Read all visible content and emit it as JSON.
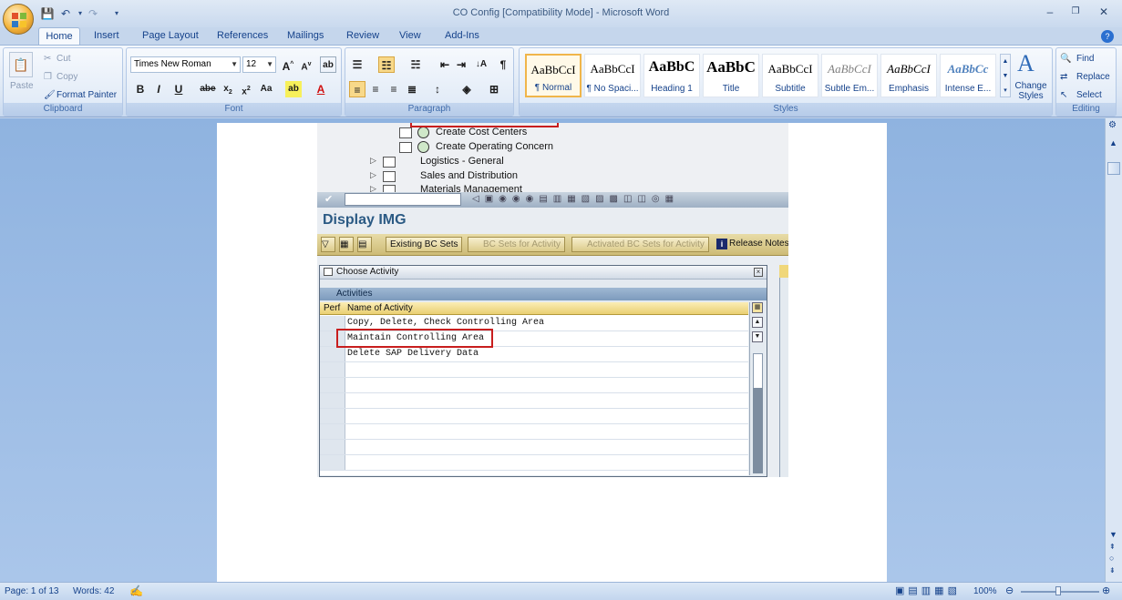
{
  "window": {
    "title": "CO Config [Compatibility Mode] - Microsoft Word",
    "controls": {
      "minimize": "–",
      "restore": "❐",
      "close": "✕"
    }
  },
  "tabs": [
    "Home",
    "Insert",
    "Page Layout",
    "References",
    "Mailings",
    "Review",
    "View",
    "Add-Ins"
  ],
  "ribbon": {
    "clipboard": {
      "label": "Clipboard",
      "paste": "Paste",
      "cut": "Cut",
      "copy": "Copy",
      "format_painter": "Format Painter"
    },
    "font": {
      "label": "Font",
      "name": "Times New Roman",
      "size": "12"
    },
    "paragraph": {
      "label": "Paragraph"
    },
    "styles": {
      "label": "Styles",
      "items": [
        {
          "preview": "AaBbCcI",
          "name": "¶ Normal"
        },
        {
          "preview": "AaBbCcI",
          "name": "¶ No Spaci..."
        },
        {
          "preview": "AaBbC",
          "name": "Heading 1"
        },
        {
          "preview": "AaBbC",
          "name": "Title"
        },
        {
          "preview": "AaBbCcI",
          "name": "Subtitle"
        },
        {
          "preview": "AaBbCcI",
          "name": "Subtle Em..."
        },
        {
          "preview": "AaBbCcI",
          "name": "Emphasis"
        },
        {
          "preview": "AaBbCc",
          "name": "Intense E..."
        }
      ],
      "change_styles": "Change Styles"
    },
    "editing": {
      "label": "Editing",
      "find": "Find",
      "replace": "Replace",
      "select": "Select"
    }
  },
  "sap": {
    "tree": [
      {
        "text": "Create Cost Centers",
        "kind": "activity"
      },
      {
        "text": "Create Operating Concern",
        "kind": "activity"
      },
      {
        "text": "Logistics - General",
        "kind": "folder"
      },
      {
        "text": "Sales and Distribution",
        "kind": "folder"
      },
      {
        "text": "Materials Management",
        "kind": "folder"
      }
    ],
    "screen_title": "Display IMG",
    "toolbar": {
      "existing_bc_sets": "Existing BC Sets",
      "bc_sets_for_activity": "BC Sets for Activity",
      "activated_bc_sets": "Activated BC Sets for Activity",
      "release_notes": "Release Notes"
    },
    "dialog": {
      "title": "Choose Activity",
      "section": "Activities",
      "col_perf": "Perf",
      "col_name": "Name of Activity",
      "rows": [
        "Copy, Delete, Check Controlling Area",
        "Maintain Controlling Area",
        "Delete SAP Delivery Data"
      ]
    }
  },
  "status": {
    "page": "Page: 1 of 13",
    "words": "Words: 42",
    "zoom": "100%"
  }
}
